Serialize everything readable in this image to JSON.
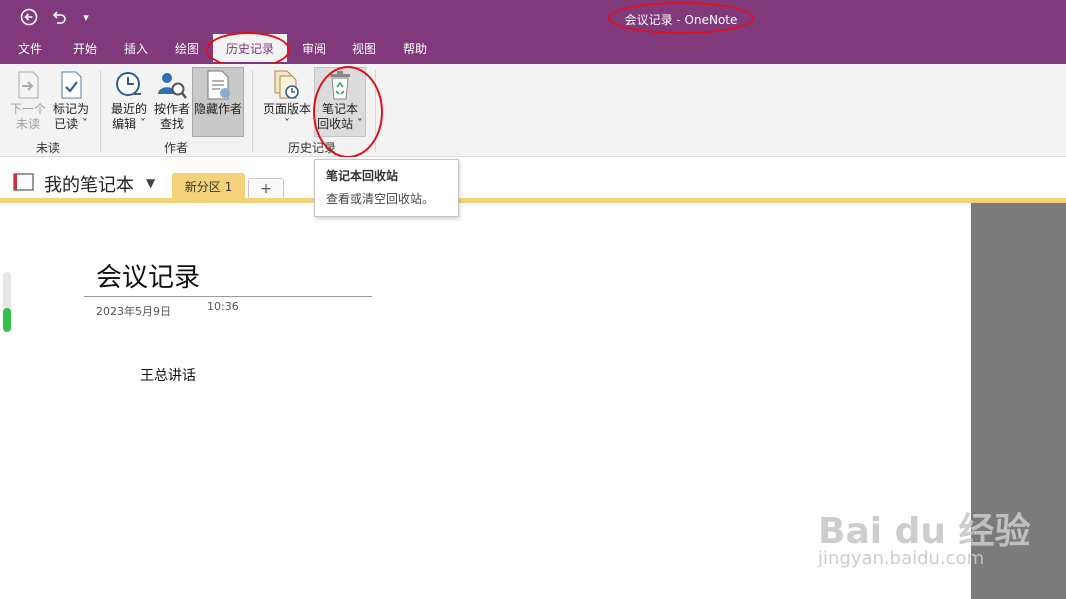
{
  "window": {
    "title": "会议记录  -  OneNote"
  },
  "menu": [
    {
      "label": "文件"
    },
    {
      "label": "开始"
    },
    {
      "label": "插入"
    },
    {
      "label": "绘图"
    },
    {
      "label": "历史记录"
    },
    {
      "label": "审阅"
    },
    {
      "label": "视图"
    },
    {
      "label": "帮助"
    }
  ],
  "ribbon": {
    "unread": {
      "next_unread": {
        "line1": "下一个",
        "line2": "未读"
      },
      "mark_as_read": {
        "line1": "标记为",
        "line2": "已读 ˇ"
      },
      "group_label": "未读"
    },
    "author": {
      "recent_edits": {
        "line1": "最近的",
        "line2": "编辑 ˇ"
      },
      "find_by_author": {
        "line1": "按作者",
        "line2": "查找"
      },
      "hide_authors": {
        "line1": "隐藏作者"
      },
      "group_label": "作者"
    },
    "history": {
      "page_versions": {
        "line1": "页面版本",
        "line2": "ˇ"
      },
      "notebook_recycle_bin": {
        "line1": "笔记本",
        "line2": "回收站 ˇ"
      },
      "group_label": "历史记录"
    }
  },
  "tooltip": {
    "title": "笔记本回收站",
    "description": "查看或清空回收站。"
  },
  "notebook": {
    "name": "我的笔记本",
    "section_tab": "新分区 1",
    "add_tab": "+"
  },
  "page": {
    "title": "会议记录",
    "date": "2023年5月9日",
    "time": "10:36",
    "body": "王总讲话"
  },
  "watermark": {
    "brand": "Bai du 经验",
    "url": "jingyan.baidu.com"
  },
  "colors": {
    "onenote_purple": "#80397b",
    "section_yellow": "#f4d27a",
    "annotation_red": "#e0101a"
  }
}
